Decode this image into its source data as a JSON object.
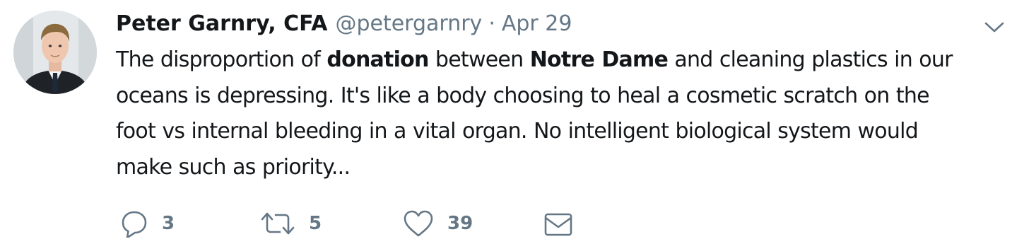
{
  "tweet": {
    "author_name": "Peter Garnry, CFA",
    "handle": "@petergarnry",
    "separator": "·",
    "date": "Apr 29",
    "text_lines": [
      [
        {
          "t": "The disproportion of ",
          "b": false
        },
        {
          "t": "donation",
          "b": true
        },
        {
          "t": " between ",
          "b": false
        },
        {
          "t": "Notre Dame",
          "b": true
        },
        {
          "t": " and cleaning plastics in our",
          "b": false
        }
      ],
      [
        {
          "t": "oceans is depressing. It's like a body choosing to heal a cosmetic scratch on the",
          "b": false
        }
      ],
      [
        {
          "t": "foot vs internal bleeding in a vital organ. No intelligent biological system would",
          "b": false
        }
      ],
      [
        {
          "t": "make such as priority...",
          "b": false
        }
      ]
    ],
    "actions": {
      "reply_count": "3",
      "retweet_count": "5",
      "like_count": "39"
    }
  },
  "icons": {
    "reply": "reply-icon",
    "retweet": "retweet-icon",
    "like": "heart-icon",
    "message": "envelope-icon",
    "caret": "chevron-down-icon"
  },
  "colors": {
    "text": "#14171a",
    "secondary": "#657786",
    "background": "#ffffff"
  }
}
